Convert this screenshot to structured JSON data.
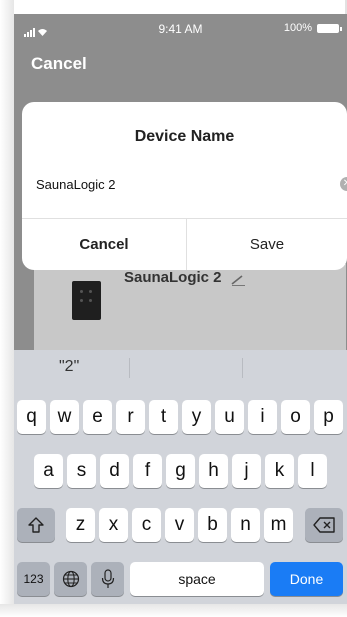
{
  "status_bar": {
    "time": "9:41 AM",
    "battery": "100%"
  },
  "nav": {
    "cancel_label": "Cancel"
  },
  "device": {
    "name": "SaunaLogic 2",
    "icon": "sauna-control-icon"
  },
  "dialog": {
    "title": "Device Name",
    "input_value": "SaunaLogic 2",
    "cancel_label": "Cancel",
    "save_label": "Save"
  },
  "keyboard": {
    "suggestions": [
      "\"2\"",
      "",
      ""
    ],
    "row1": [
      "q",
      "w",
      "e",
      "r",
      "t",
      "y",
      "u",
      "i",
      "o",
      "p"
    ],
    "row2": [
      "a",
      "s",
      "d",
      "f",
      "g",
      "h",
      "j",
      "k",
      "l"
    ],
    "row3": [
      "z",
      "x",
      "c",
      "v",
      "b",
      "n",
      "m"
    ],
    "numbers_label": "123",
    "space_label": "space",
    "done_label": "Done",
    "done_color": "#1a7cf5"
  }
}
